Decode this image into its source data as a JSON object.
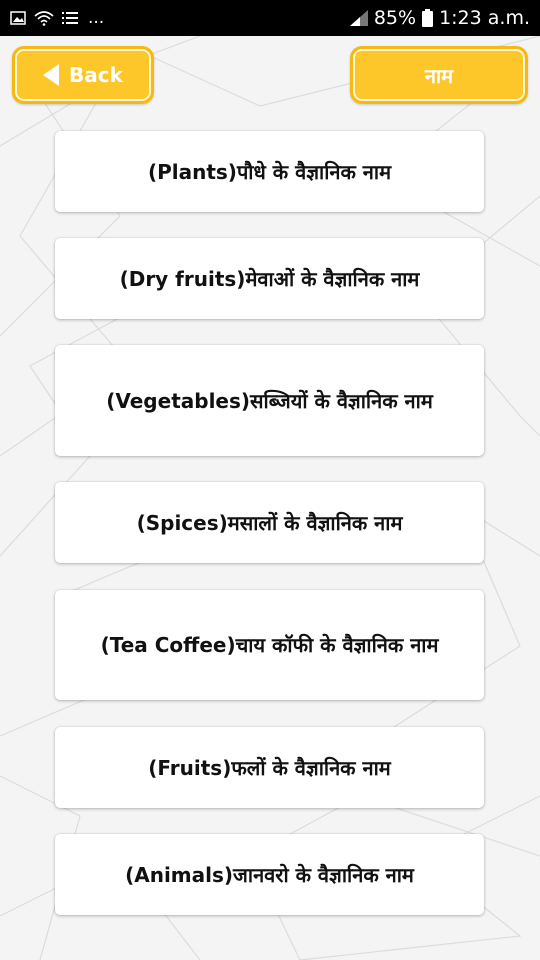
{
  "status_bar": {
    "notification_dots": "...",
    "battery_percent": "85%",
    "time": "1:23 a.m."
  },
  "header": {
    "back_label": "Back",
    "title_button_label": "नाम"
  },
  "list": {
    "items": [
      {
        "label": "(Plants)पौधे के वैज्ञानिक नाम"
      },
      {
        "label": "(Dry fruits)मेवाओं के वैज्ञानिक नाम"
      },
      {
        "label": "(Vegetables)सब्जियों के वैज्ञानिक नाम"
      },
      {
        "label": "(Spices)मसालों के वैज्ञानिक नाम"
      },
      {
        "label": "(Tea Coffee)चाय कॉफी के वैज्ञानिक नाम"
      },
      {
        "label": "(Fruits)फलों के वैज्ञानिक नाम"
      },
      {
        "label": "(Animals)जानवरो के वैज्ञानिक नाम"
      }
    ]
  },
  "colors": {
    "accent": "#fdc629",
    "accent_border": "#f7b911",
    "background": "#f4f4f4",
    "status_bar": "#000000"
  }
}
